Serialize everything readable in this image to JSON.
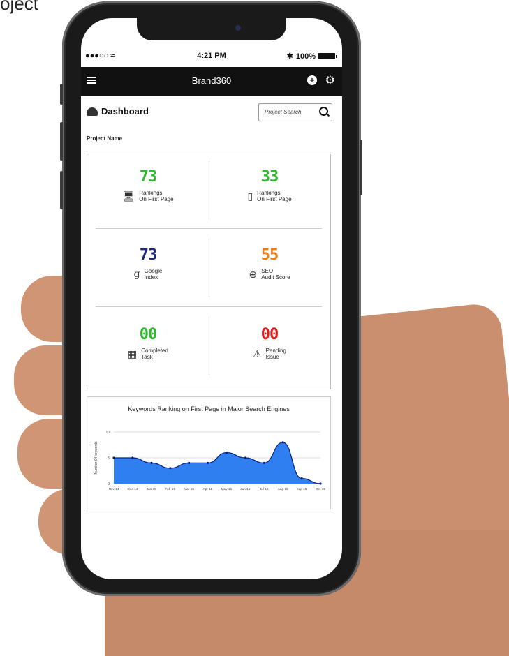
{
  "corner_text": "oject",
  "status_bar": {
    "signal": "●●●○○ ",
    "time": "4:21 PM",
    "battery": "100%"
  },
  "app_bar": {
    "title": "Brand360"
  },
  "dashboard": {
    "title": "Dashboard",
    "search_placeholder": "Project Search",
    "project_label": "Project Name"
  },
  "stats": [
    {
      "value": "73",
      "label1": "Rankings",
      "label2": "On First Page",
      "color": "#2fb82f",
      "icon": "desktop-icon"
    },
    {
      "value": "33",
      "label1": "Rankings",
      "label2": "On First Page",
      "color": "#2fb82f",
      "icon": "mobile-icon"
    },
    {
      "value": "73",
      "label1": "Google",
      "label2": "Index",
      "color": "#1f2a7a",
      "icon": "google-icon"
    },
    {
      "value": "55",
      "label1": "SEO",
      "label2": "Audit Score",
      "color": "#ef7d12",
      "icon": "seo-search-icon"
    },
    {
      "value": "00",
      "label1": "Completed",
      "label2": "Task",
      "color": "#2fb82f",
      "icon": "calendar-icon"
    },
    {
      "value": "00",
      "label1": "Pending",
      "label2": "Issue",
      "color": "#e31b1b",
      "icon": "warning-icon"
    }
  ],
  "chart_data": {
    "type": "area",
    "title": "Keywords Ranking on First Page in Major Search Engines",
    "ylabel": "Number Of keywords",
    "categories": [
      "Nov-14",
      "Dec-14",
      "Jan-15",
      "Feb-15",
      "Mar-15",
      "Apr-15",
      "May-15",
      "Jun-15",
      "Jul-15",
      "Aug-15",
      "Sep-15",
      "Oct-15"
    ],
    "values": [
      5,
      5,
      4,
      3,
      4,
      4,
      6,
      5,
      4,
      8,
      1,
      0
    ],
    "ylim": [
      0,
      10
    ],
    "yticks": [
      "0",
      "5",
      "10"
    ],
    "fill_color": "#2f7ff0",
    "line_color": "#0b1f7a"
  }
}
